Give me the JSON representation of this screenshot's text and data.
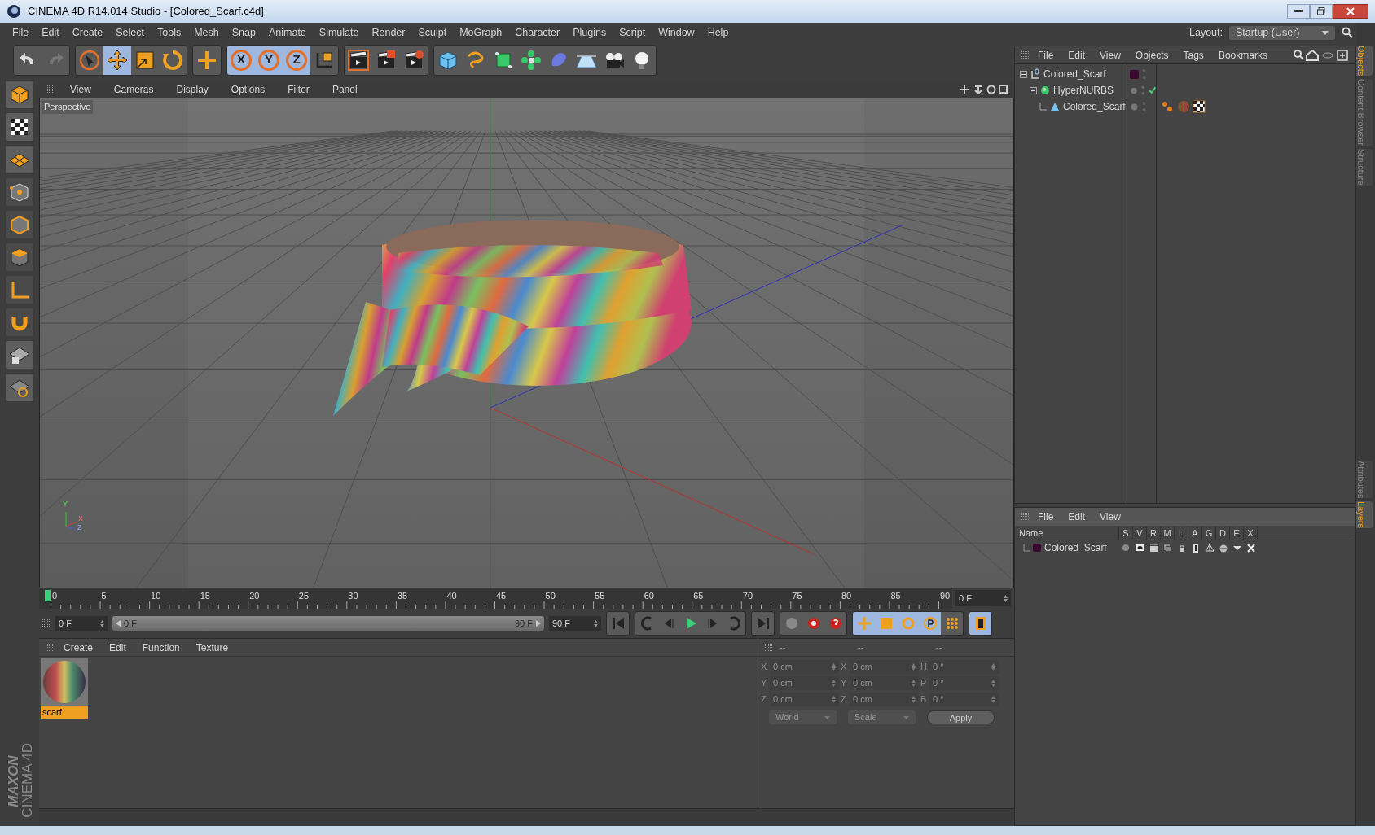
{
  "window": {
    "title": "CINEMA 4D R14.014 Studio - [Colored_Scarf.c4d]"
  },
  "menu": [
    "File",
    "Edit",
    "Create",
    "Select",
    "Tools",
    "Mesh",
    "Snap",
    "Animate",
    "Simulate",
    "Render",
    "Sculpt",
    "MoGraph",
    "Character",
    "Plugins",
    "Script",
    "Window",
    "Help"
  ],
  "layout": {
    "label": "Layout:",
    "value": "Startup (User)"
  },
  "toolbar": {
    "tools": [
      {
        "kind": "select",
        "selected": false
      },
      {
        "kind": "move",
        "selected": true
      },
      {
        "kind": "scale",
        "selected": false
      },
      {
        "kind": "rotate",
        "selected": false
      },
      {
        "kind": "live",
        "selected": false
      }
    ],
    "axis_locks": [
      {
        "label": "X",
        "on": true
      },
      {
        "label": "Y",
        "on": true
      },
      {
        "label": "Z",
        "on": true
      }
    ]
  },
  "viewport": {
    "menu": [
      "View",
      "Cameras",
      "Display",
      "Options",
      "Filter",
      "Panel"
    ],
    "label": "Perspective",
    "axis_labels": [
      "Y",
      "X",
      "Z"
    ]
  },
  "timeline": {
    "ticks": [
      "0",
      "5",
      "10",
      "15",
      "20",
      "25",
      "30",
      "35",
      "40",
      "45",
      "50",
      "55",
      "60",
      "65",
      "70",
      "75",
      "80",
      "85",
      "90"
    ],
    "current_frame": "0 F",
    "start": "0 F",
    "range_slider": {
      "level": 1
    },
    "range_start": "0 F",
    "range_end": "90 F",
    "end": "90 F"
  },
  "materials": {
    "menu": [
      "Create",
      "Edit",
      "Function",
      "Texture"
    ],
    "items": [
      {
        "name": "scarf",
        "selected": true
      }
    ]
  },
  "coordinates": {
    "disabled": true,
    "headers": [
      "--",
      "--",
      "--"
    ],
    "groups": [
      [
        {
          "label": "X",
          "value": "0 cm"
        },
        {
          "label": "Y",
          "value": "0 cm"
        },
        {
          "label": "Z",
          "value": "0 cm"
        }
      ],
      [
        {
          "label": "X",
          "value": "0 cm"
        },
        {
          "label": "Y",
          "value": "0 cm"
        },
        {
          "label": "Z",
          "value": "0 cm"
        }
      ],
      [
        {
          "label": "H",
          "value": "0 °"
        },
        {
          "label": "P",
          "value": "0 °"
        },
        {
          "label": "B",
          "value": "0 °"
        }
      ]
    ],
    "dropdowns": [
      "World",
      "Scale"
    ],
    "apply": "Apply"
  },
  "objects": {
    "menu": [
      "File",
      "Edit",
      "View",
      "Objects",
      "Tags",
      "Bookmarks"
    ],
    "tree": [
      {
        "name": "Colored_Scarf",
        "kind": "null",
        "expanded": true,
        "color": "#3a0a30",
        "children": [
          {
            "name": "HyperNURBS",
            "kind": "hypernurbs",
            "expanded": true,
            "enabled": true,
            "children": [
              {
                "name": "Colored_Scarf",
                "kind": "polygon",
                "tags": [
                  {
                    "kind": "phong"
                  },
                  {
                    "kind": "material"
                  },
                  {
                    "kind": "uvw"
                  }
                ]
              }
            ]
          }
        ]
      }
    ]
  },
  "layers": {
    "menu": [
      "File",
      "Edit",
      "View"
    ],
    "columns": [
      "Name",
      "S",
      "V",
      "R",
      "M",
      "L",
      "A",
      "G",
      "D",
      "E",
      "X"
    ],
    "rows": [
      {
        "name": "Colored_Scarf",
        "color": "#3a0a30"
      }
    ]
  },
  "side_tabs_top": [
    {
      "label": "Objects",
      "selected": true
    },
    {
      "label": "Content Browser",
      "selected": false
    },
    {
      "label": "Structure",
      "selected": false
    }
  ],
  "side_tabs_bottom": [
    {
      "label": "Attributes",
      "selected": false
    },
    {
      "label": "Layers",
      "selected": true
    }
  ],
  "brand": [
    "MAXON",
    "CINEMA 4D"
  ]
}
